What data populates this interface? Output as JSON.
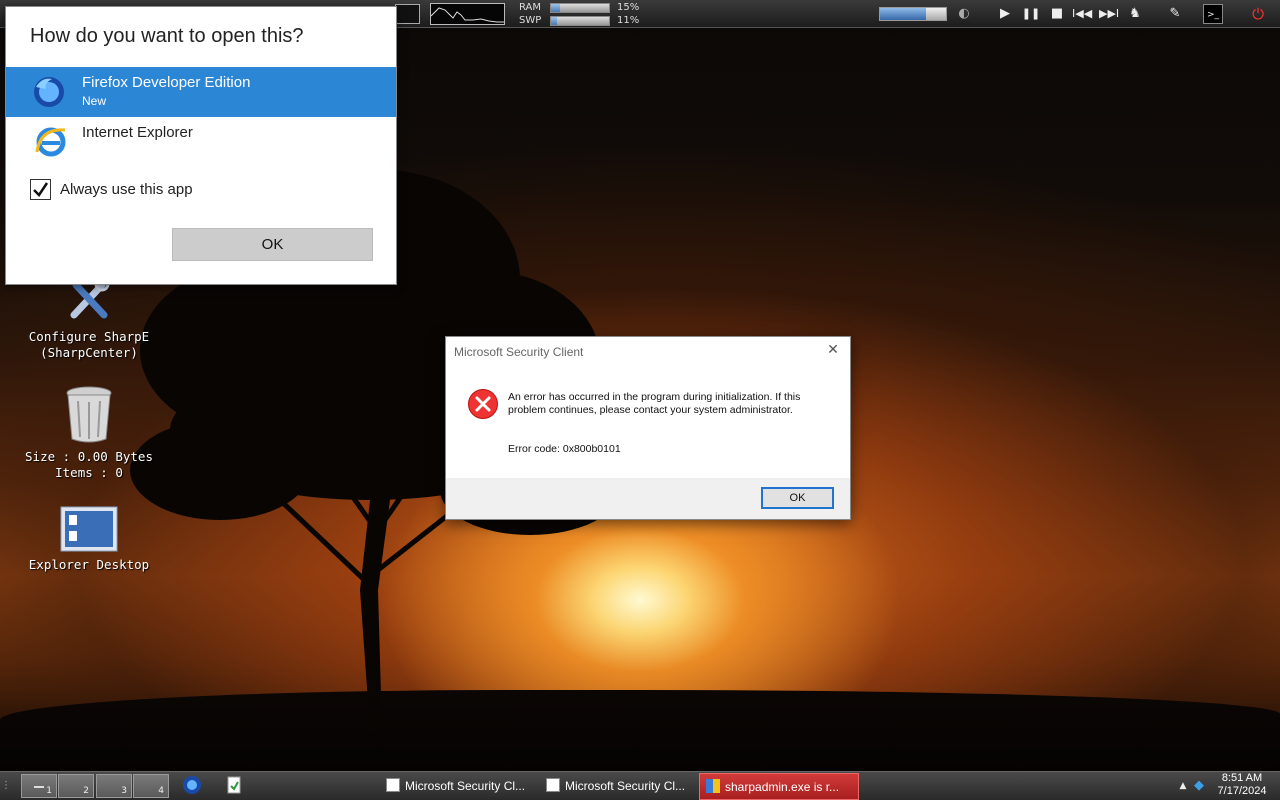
{
  "topbar": {
    "ram_label": "RAM",
    "ram_value": "15%",
    "ram_fraction": 0.15,
    "swp_label": "SWP",
    "swp_value": "11%",
    "swp_fraction": 0.11,
    "media_icons": [
      "play-icon",
      "pause-icon",
      "stop-icon",
      "previous-icon",
      "next-icon"
    ],
    "volume_fraction": 0.7
  },
  "desktop_icons": [
    {
      "line1": "Configure SharpE",
      "line2": "(SharpCenter)"
    },
    {
      "line1": "Size : 0.00 Bytes",
      "line2": "Items : 0"
    },
    {
      "line1": "Explorer Desktop",
      "line2": ""
    }
  ],
  "open_with": {
    "title": "How do you want to open this?",
    "apps": [
      {
        "name": "Firefox Developer Edition",
        "sub": "New",
        "selected": true
      },
      {
        "name": "Internet Explorer",
        "sub": "",
        "selected": false
      }
    ],
    "always_use_label": "Always use this app",
    "always_use_checked": true,
    "ok_label": "OK"
  },
  "security_dialog": {
    "title": "Microsoft Security Client",
    "message": "An error has occurred in the program during initialization. If this problem continues, please contact your system administrator.",
    "error_code": "Error code: 0x800b0101",
    "ok_label": "OK"
  },
  "taskbar": {
    "workspaces": [
      "1",
      "2",
      "3",
      "4"
    ],
    "tasks": [
      {
        "label": "Microsoft Security Cl...",
        "active": false
      },
      {
        "label": "Microsoft Security Cl...",
        "active": false
      },
      {
        "label": "sharpadmin.exe is r...",
        "active": true
      }
    ],
    "time": "8:51 AM",
    "date": "7/17/2024"
  },
  "colors": {
    "selection_blue": "#2c86d6",
    "active_task_red": "#c02a2a",
    "error_red": "#e33333"
  }
}
